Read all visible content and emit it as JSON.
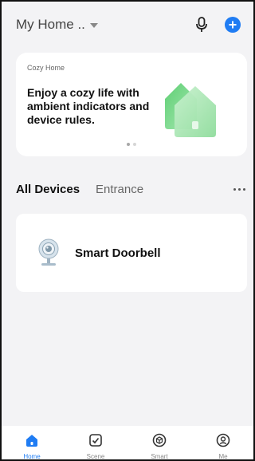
{
  "header": {
    "home_title": "My Home ..",
    "mic_icon": "microphone-icon",
    "add_icon": "plus-circle-icon"
  },
  "banner": {
    "tag": "Cozy Home",
    "headline": "Enjoy a cozy life with ambient indicators and device rules.",
    "page_count": 2,
    "active_page": 1,
    "art_icon": "house-illustration"
  },
  "tabs": [
    {
      "label": "All Devices",
      "active": true
    },
    {
      "label": "Entrance",
      "active": false
    }
  ],
  "devices": [
    {
      "name": "Smart Doorbell",
      "icon": "doorbell-camera-icon"
    }
  ],
  "nav": [
    {
      "label": "Home",
      "icon": "home-icon",
      "active": true
    },
    {
      "label": "Scene",
      "icon": "scene-check-icon",
      "active": false
    },
    {
      "label": "Smart",
      "icon": "smart-cube-icon",
      "active": false
    },
    {
      "label": "Me",
      "icon": "profile-icon",
      "active": false
    }
  ],
  "colors": {
    "accent": "#1f7cf3",
    "background": "#f3f3f5",
    "card": "#ffffff",
    "house_green": "#7fd88e"
  }
}
